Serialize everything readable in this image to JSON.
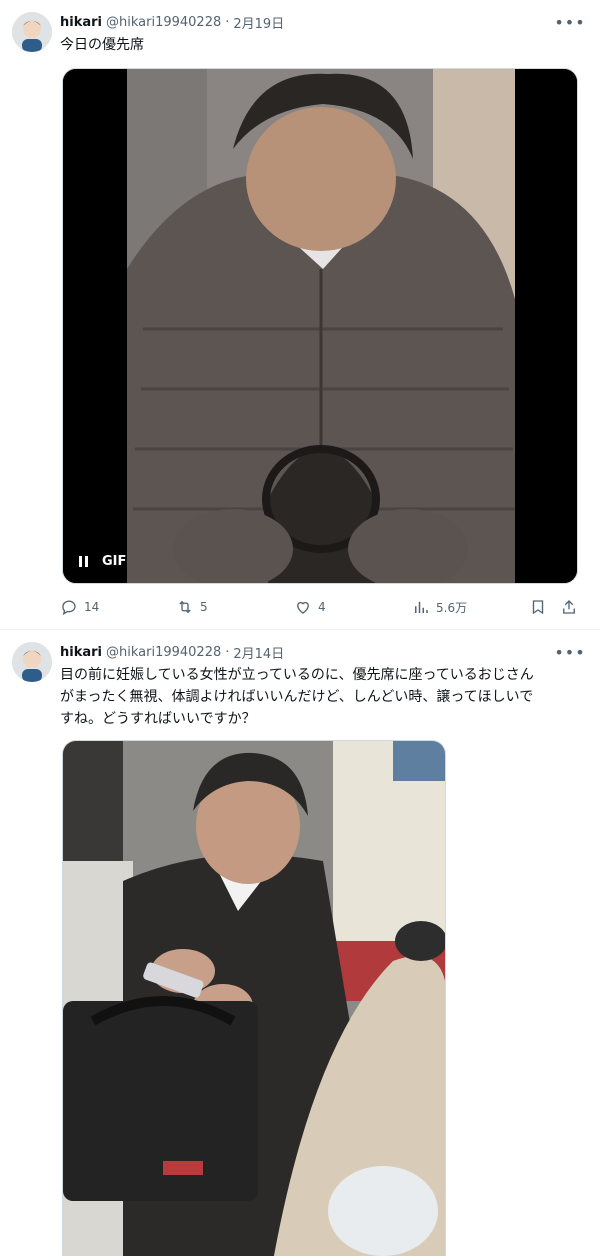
{
  "tweets": [
    {
      "display_name": "hikari",
      "handle": "@hikari19940228",
      "separator": "·",
      "date": "2月19日",
      "text": "今日の優先席",
      "media": {
        "type": "gif",
        "gif_label": "GIF"
      },
      "actions": {
        "replies": "14",
        "reposts": "5",
        "likes": "4",
        "views": "5.6万"
      }
    },
    {
      "display_name": "hikari",
      "handle": "@hikari19940228",
      "separator": "·",
      "date": "2月14日",
      "text_lines": [
        "目の前に妊娠している女性が立っているのに、優先席に座っているおじさん",
        "がまったく無視、体調よければいいんだけど、しんどい時、譲ってほしいで",
        "すね。どうすればいいですか？"
      ],
      "media": {
        "type": "photo"
      }
    }
  ],
  "icons": {
    "more": "more-horizontal-icon",
    "reply": "reply-icon",
    "repost": "repost-icon",
    "like": "heart-icon",
    "views": "views-icon",
    "bookmark": "bookmark-icon",
    "share": "share-icon",
    "pause": "pause-icon"
  },
  "colors": {
    "text": "#0f1419",
    "secondary": "#536471",
    "border": "#eff3f4"
  }
}
